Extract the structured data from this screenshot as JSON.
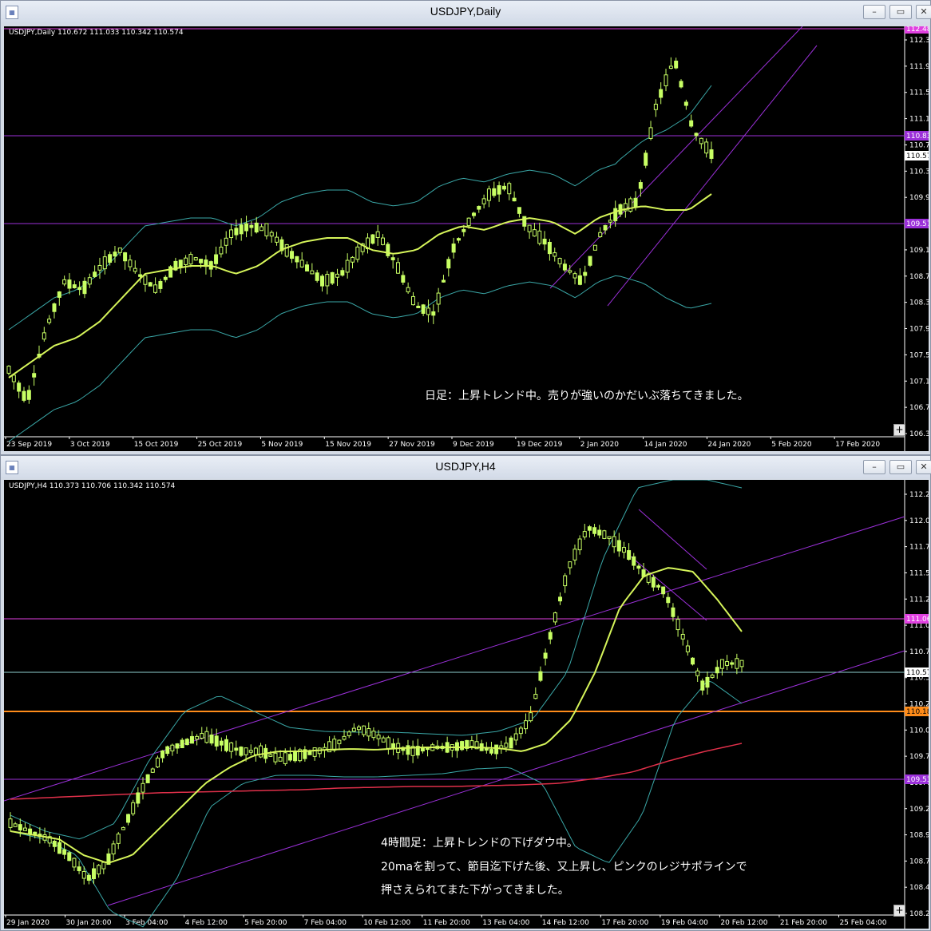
{
  "window_top": {
    "title": "USDJPY,Daily",
    "info": "USDJPY,Daily  110.672 111.033 110.342 110.574",
    "note": "日足：上昇トレンド中。売りが強いのかだいぶ落ちてきました。",
    "price_ticks": [
      "112.31",
      "111.91",
      "111.52",
      "111.12",
      "110.72",
      "110.33",
      "109.93",
      "109.53",
      "109.14",
      "108.74",
      "108.34",
      "107.95",
      "107.55",
      "107.15",
      "106.76",
      "106.36"
    ],
    "price_labels": {
      "top": "112.48",
      "mid": "110.83",
      "current": "110.57",
      "low": "109.57"
    },
    "date_ticks": [
      "23 Sep 2019",
      "3 Oct 2019",
      "15 Oct 2019",
      "25 Oct 2019",
      "5 Nov 2019",
      "15 Nov 2019",
      "27 Nov 2019",
      "9 Dec 2019",
      "19 Dec 2019",
      "2 Jan 2020",
      "14 Jan 2020",
      "24 Jan 2020",
      "5 Feb 2020",
      "17 Feb 2020"
    ]
  },
  "window_bottom": {
    "title": "USDJPY,H4",
    "info": "USDJPY,H4  110.373 110.706 110.342 110.574",
    "note_lines": [
      "4時間足：上昇トレンドの下げダウ中。",
      "20maを割って、節目迄下げた後、又上昇し、ピンクのレジサポラインで",
      "押さえられてまた下がってきました。"
    ],
    "price_ticks": [
      "112.29",
      "112.03",
      "111.78",
      "111.53",
      "111.27",
      "111.02",
      "110.76",
      "110.51",
      "110.25",
      "110.00",
      "109.74",
      "109.49",
      "109.23",
      "108.98",
      "108.72",
      "108.47",
      "108.22"
    ],
    "price_labels": {
      "pink": "111.06",
      "current": "110.57",
      "orange": "110.18",
      "purple": "109.53"
    },
    "date_ticks": [
      "29 Jan 2020",
      "30 Jan 20:00",
      "3 Feb 04:00",
      "4 Feb 12:00",
      "5 Feb 20:00",
      "7 Feb 04:00",
      "10 Feb 12:00",
      "11 Feb 20:00",
      "13 Feb 04:00",
      "14 Feb 12:00",
      "17 Feb 20:00",
      "19 Feb 04:00",
      "20 Feb 12:00",
      "21 Feb 20:00",
      "25 Feb 04:00"
    ]
  },
  "window_buttons": {
    "minimize": "–",
    "restore": "▭",
    "close": "✕"
  },
  "colors": {
    "background": "#000000",
    "bull": "#c8ff64",
    "ma": "#d6f55a",
    "bands": "#3aa7a7",
    "hline_purple": "#9b30d9",
    "hline_pink": "#e040e0",
    "orange": "#ff8c1a",
    "ma_red": "#e0304a"
  }
}
